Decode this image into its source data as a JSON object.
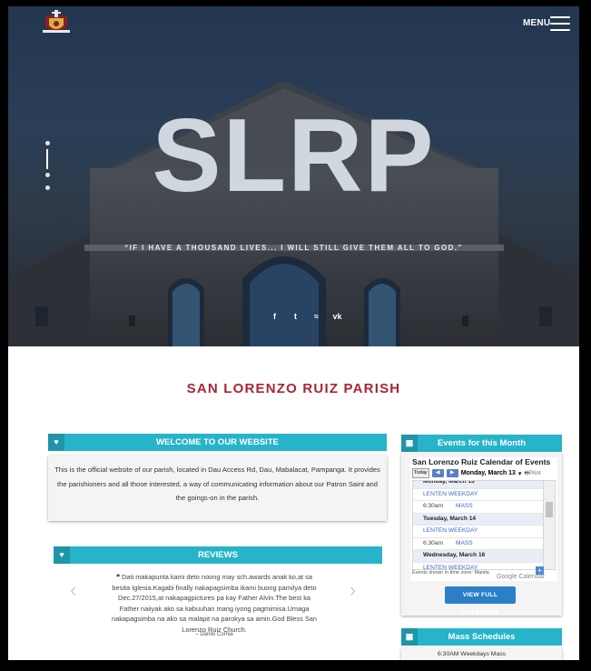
{
  "header": {
    "menu_label": "MENU"
  },
  "hero": {
    "title": "SLRP",
    "quote": "“IF I HAVE A THOUSAND LIVES... I WILL STILL GIVE THEM ALL TO GOD.”",
    "social": [
      {
        "icon": "facebook-icon",
        "glyph": "f"
      },
      {
        "icon": "twitter-icon",
        "glyph": "t"
      },
      {
        "icon": "rss-icon",
        "glyph": "≈"
      },
      {
        "icon": "vk-icon",
        "glyph": "vk"
      }
    ]
  },
  "main": {
    "parish_title": "SAN LORENZO RUIZ PARISH",
    "welcome": {
      "heading": "WELCOME TO OUR WEBSITE",
      "body": "This is the official website of our parish, located in Dau Access Rd, Dau, Mabalacat, Pampanga. It provides the parishioners and all those interested, a way of communicating information about our Patron Saint and the goings-on in the parish."
    },
    "reviews": {
      "heading": "REVIEWS",
      "quote_mark": "❝",
      "text": "Dati makapunta kami deto noong may sch.awards anak ko,at sa besita Iglesia.Kagabi finally nakapagsimba ikami buong pamilya deto Dec.27/2015,at nakapagpictures pa kay Father Alvin.The best ka Father naiiyak ako sa kabuuhan mang iyong pagmimisa.Umaga nakapagsimba na ako sa malapit na parokya sa amin.God Bless San Lorenzo Ruiz Church.",
      "author": "– Danilo Cornia"
    }
  },
  "events": {
    "heading": "Events for this Month",
    "calendar_title": "San Lorenzo Ruiz Calendar of Events",
    "today_label": "Today",
    "current_date": "Monday, March 13",
    "print_label": "Print",
    "rows": [
      {
        "kind": "date",
        "text": "Monday, March 13"
      },
      {
        "kind": "ev",
        "text": "LENTEN WEEKDAY"
      },
      {
        "kind": "t",
        "time": "6:30am",
        "title": "MASS"
      },
      {
        "kind": "date",
        "text": "Tuesday, March 14"
      },
      {
        "kind": "ev",
        "text": "LENTEN WEEKDAY"
      },
      {
        "kind": "t",
        "time": "6:30am",
        "title": "MASS"
      },
      {
        "kind": "date",
        "text": "Wednesday, March 15"
      },
      {
        "kind": "ev",
        "text": "LENTEN WEEKDAY"
      },
      {
        "kind": "t",
        "time": "6:30am",
        "title": "MASS"
      },
      {
        "kind": "date",
        "text": "Wednesday, March 16"
      },
      {
        "kind": "ev",
        "text": "LENTEN WEEKDAY"
      }
    ],
    "timezone_note": "Events shown in time zone: Manila",
    "gcal_label": "Google Calendar",
    "view_button": "VIEW FULL CALENDAR"
  },
  "mass": {
    "heading": "Mass Schedules",
    "first_line": "6:30AM  Weekdays Mass"
  },
  "colors": {
    "accent": "#27b3c9",
    "title_red": "#a6263a",
    "button_blue": "#2b7fc7"
  }
}
